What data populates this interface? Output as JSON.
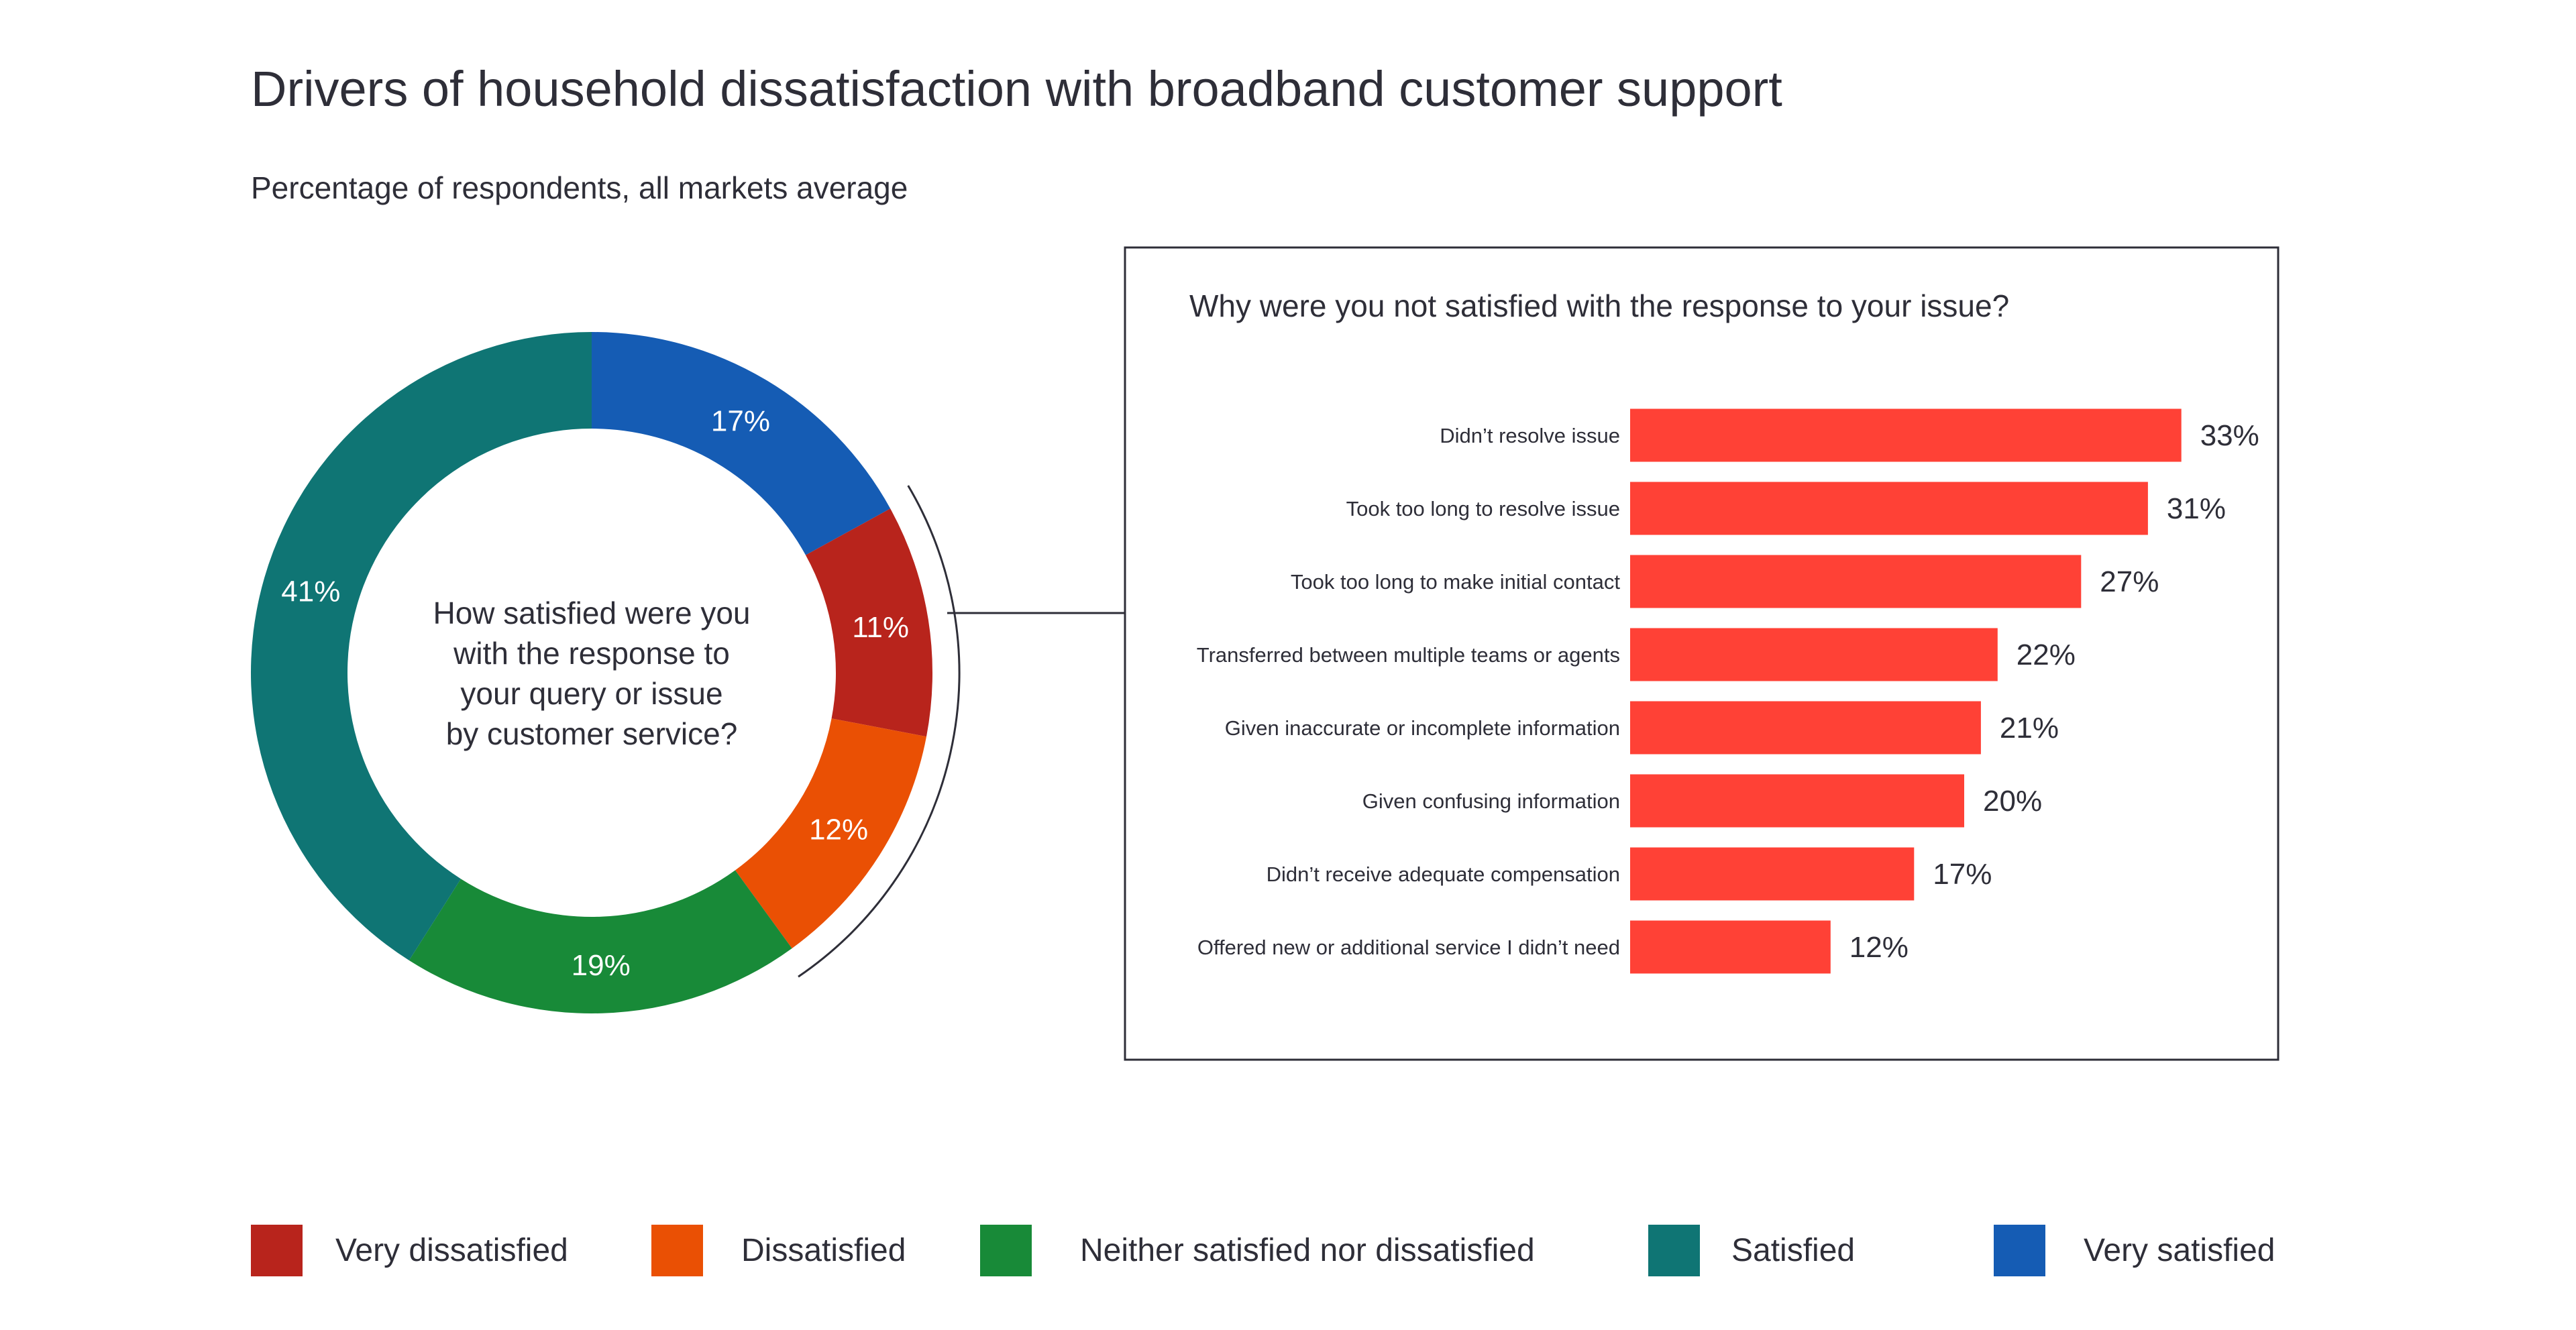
{
  "title": "Drivers of household dissatisfaction with broadband customer support",
  "subtitle": "Percentage of respondents, all markets average",
  "chart_data": [
    {
      "type": "pie",
      "variant": "donut",
      "center_text": [
        "How satisfied were you",
        "with the response to",
        "your query or issue",
        "by customer service?"
      ],
      "slices": [
        {
          "name": "Very satisfied",
          "value": 17,
          "label": "17%",
          "color": "#155CB4"
        },
        {
          "name": "Very dissatisfied",
          "value": 11,
          "label": "11%",
          "color": "#B8241C"
        },
        {
          "name": "Dissatisfied",
          "value": 12,
          "label": "12%",
          "color": "#EA5004"
        },
        {
          "name": "Neither satisfied nor dissatisfied",
          "value": 19,
          "label": "19%",
          "color": "#188A38"
        },
        {
          "name": "Satisfied",
          "value": 41,
          "label": "41%",
          "color": "#0F7574"
        }
      ],
      "legend": {
        "placement": "bottom",
        "items": [
          {
            "label": "Very dissatisfied",
            "color": "#B8241C"
          },
          {
            "label": "Dissatisfied",
            "color": "#EA5004"
          },
          {
            "label": "Neither satisfied nor dissatisfied",
            "color": "#188A38"
          },
          {
            "label": "Satisfied",
            "color": "#0F7574"
          },
          {
            "label": "Very satisfied",
            "color": "#155CB4"
          }
        ]
      }
    },
    {
      "type": "bar",
      "orientation": "horizontal",
      "title": "Why were you not satisfied with the response to your issue?",
      "bar_color": "#FF4136",
      "categories": [
        "Didn’t resolve issue",
        "Took too long to resolve issue",
        "Took too long to make initial contact",
        "Transferred between multiple teams or agents",
        "Given inaccurate or incomplete information",
        "Given confusing information",
        "Didn’t receive adequate compensation",
        "Offered new or additional service I didn’t need"
      ],
      "values": [
        33,
        31,
        27,
        22,
        21,
        20,
        17,
        12
      ],
      "value_labels": [
        "33%",
        "31%",
        "27%",
        "22%",
        "21%",
        "20%",
        "17%",
        "12%"
      ],
      "grid": false
    }
  ]
}
